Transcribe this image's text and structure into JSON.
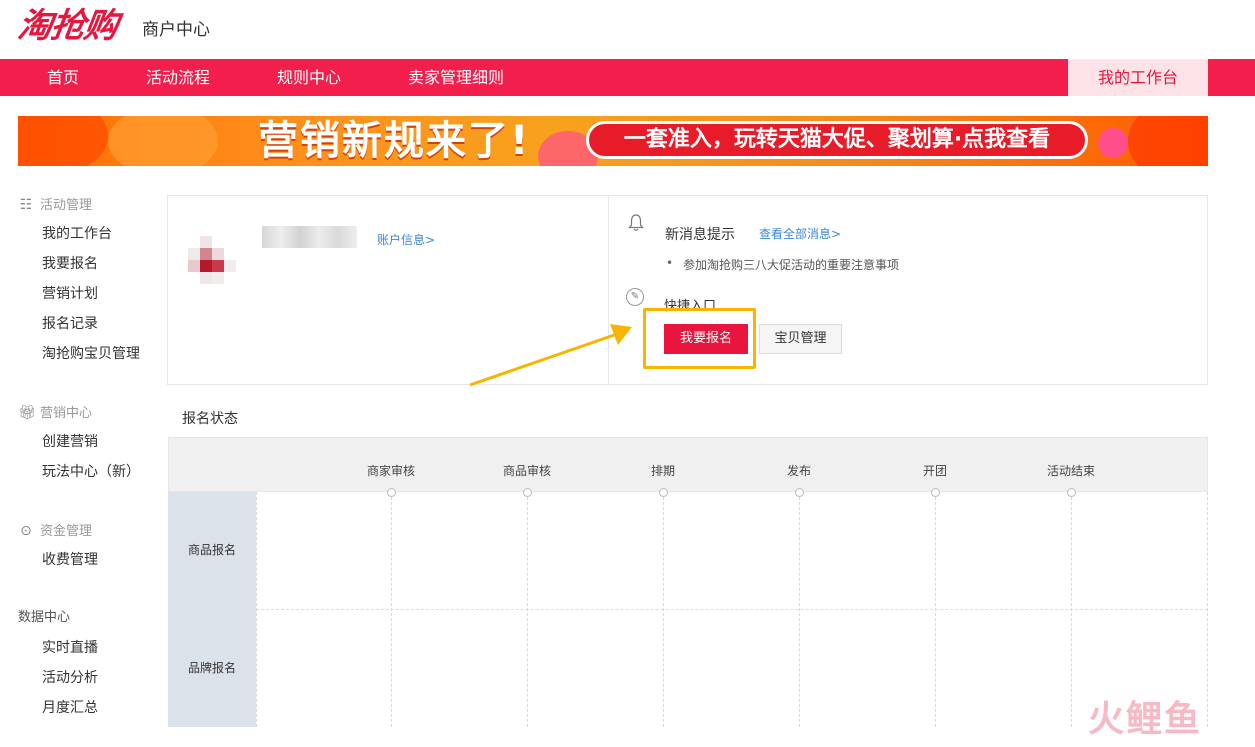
{
  "header": {
    "logo_text": "淘抢购",
    "subtitle": "商户中心"
  },
  "nav": {
    "items": [
      "首页",
      "活动流程",
      "规则中心",
      "卖家管理细则"
    ],
    "workspace_label": "我的工作台"
  },
  "banner": {
    "title": "营销新规来了!",
    "pill_text": "一套准入，玩转天猫大促、聚划算·点我查看"
  },
  "sidebar": {
    "sections": [
      {
        "title": "活动管理",
        "icon": "list-icon",
        "items": [
          "我的工作台",
          "我要报名",
          "营销计划",
          "报名记录",
          "淘抢购宝贝管理"
        ]
      },
      {
        "title": "营销中心",
        "icon": "gift-icon",
        "items": [
          "创建营销",
          "玩法中心（新）"
        ]
      },
      {
        "title": "资金管理",
        "icon": "money-icon",
        "items": [
          "收费管理"
        ]
      },
      {
        "title": "数据中心",
        "icon": "",
        "items": [
          "实时直播",
          "活动分析",
          "月度汇总"
        ]
      }
    ]
  },
  "account": {
    "link_text": "账户信息>"
  },
  "messages": {
    "title": "新消息提示",
    "view_all": "查看全部消息>",
    "bullet": "•",
    "items": [
      "参加淘抢购三八大促活动的重要注意事项"
    ]
  },
  "quick_entry": {
    "title": "快捷入口",
    "buttons": [
      "我要报名",
      "宝贝管理"
    ]
  },
  "status": {
    "title": "报名状态",
    "columns": [
      "商家审核",
      "商品审核",
      "排期",
      "发布",
      "开团",
      "活动结束"
    ],
    "rows": [
      "商品报名",
      "品牌报名"
    ]
  },
  "watermark": "火鲤鱼",
  "colors": {
    "brand_red": "#f21e4c",
    "highlight": "#f7b500",
    "link_blue": "#3a87d8"
  }
}
